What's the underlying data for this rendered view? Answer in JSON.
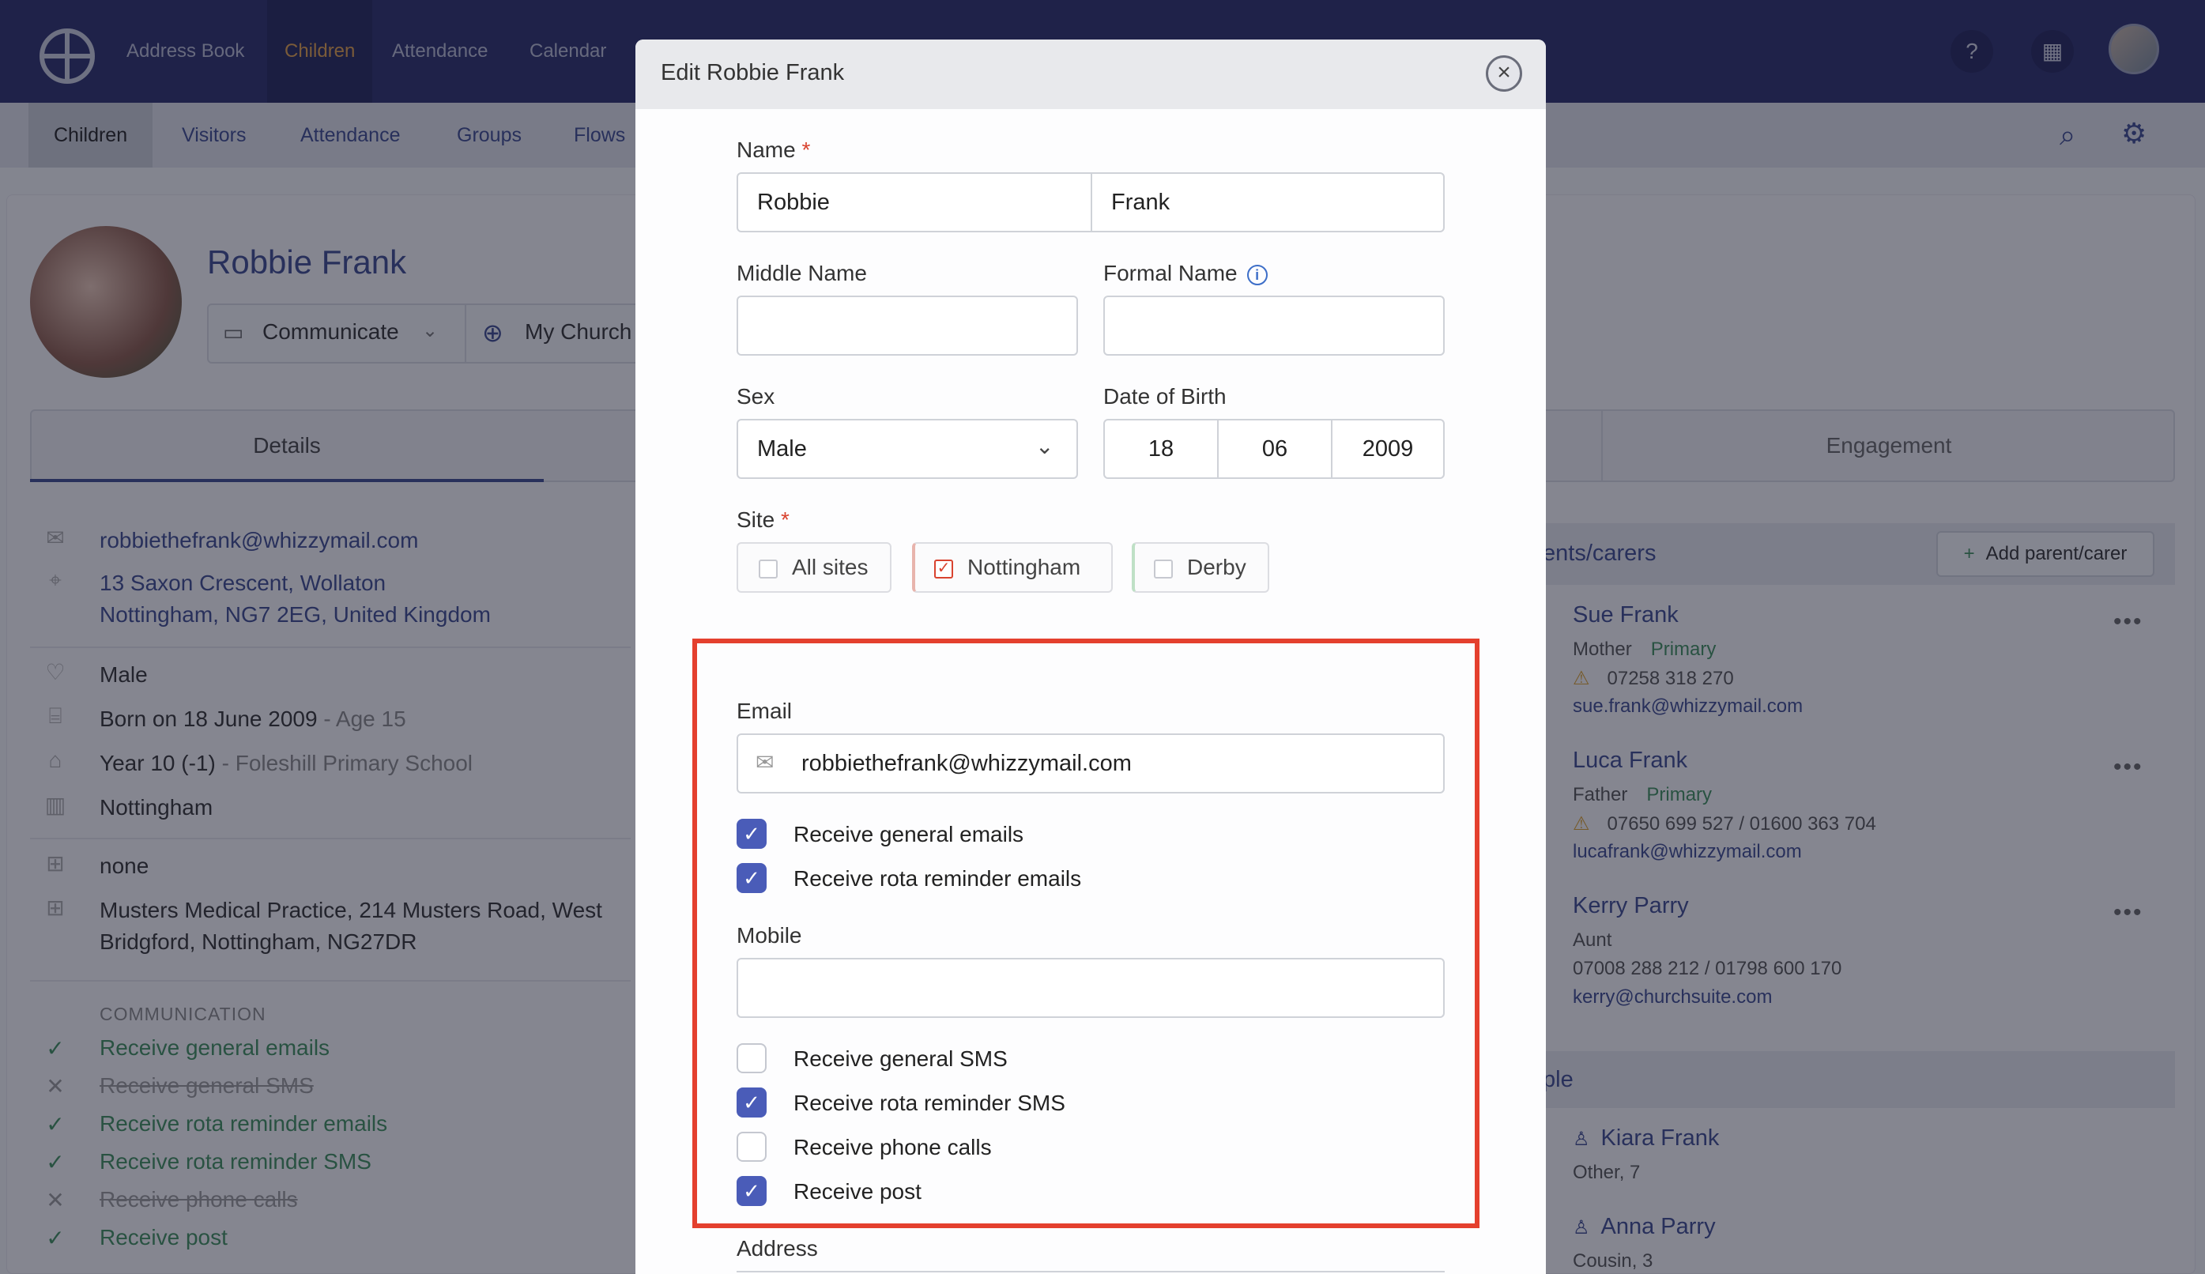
{
  "topnav": {
    "items": [
      "Address Book",
      "Children",
      "Attendance",
      "Calendar"
    ],
    "active": "Children",
    "help_icon": "question-circle-icon",
    "building_icon": "building-icon"
  },
  "subnav": {
    "items": [
      "Children",
      "Visitors",
      "Attendance",
      "Groups",
      "Flows"
    ],
    "active": "Children"
  },
  "profile": {
    "name": "Robbie Frank",
    "communicate": "Communicate",
    "church": "My Church",
    "tabs": {
      "details": "Details",
      "engagement": "Engagement"
    },
    "email": "robbiethefrank@whizzymail.com",
    "address_line1": "13 Saxon Crescent, Wollaton",
    "address_line2": "Nottingham, NG7 2EG, United Kingdom",
    "sex": "Male",
    "born": "Born on 18 June 2009",
    "age": " - Age 15",
    "school_year": "Year 10 (-1)",
    "school": " - Foleshill Primary School",
    "site": "Nottingham",
    "medical_none": "none",
    "doctor_line1": "Musters Medical Practice, 214 Musters Road, West",
    "doctor_line2": "Bridgford, Nottingham, NG27DR",
    "communication_heading": "COMMUNICATION",
    "communication": [
      {
        "label": "Receive general emails",
        "enabled": true
      },
      {
        "label": "Receive general SMS",
        "enabled": false
      },
      {
        "label": "Receive rota reminder emails",
        "enabled": true
      },
      {
        "label": "Receive rota reminder SMS",
        "enabled": true
      },
      {
        "label": "Receive phone calls",
        "enabled": false
      },
      {
        "label": "Receive post",
        "enabled": true
      }
    ]
  },
  "relations": {
    "title": "ents/carers",
    "add_button": "Add parent/carer",
    "carers": [
      {
        "name": "Sue Frank",
        "role": "Mother",
        "primary": "Primary",
        "phone": "07258 318 270",
        "email": "sue.frank@whizzymail.com",
        "warning": true
      },
      {
        "name": "Luca Frank",
        "role": "Father",
        "primary": "Primary",
        "phone": "07650 699 527 / 01600 363 704",
        "email": "lucafrank@whizzymail.com",
        "warning": true
      },
      {
        "name": "Kerry Parry",
        "role": "Aunt",
        "primary": "",
        "phone": "07008 288 212 / 01798 600 170",
        "email": "kerry@churchsuite.com",
        "warning": false
      }
    ],
    "people_title": "ple",
    "people": [
      {
        "name": "Kiara Frank",
        "detail": "Other, 7"
      },
      {
        "name": "Anna Parry",
        "detail": "Cousin, 3"
      }
    ]
  },
  "modal": {
    "title": "Edit Robbie Frank",
    "name_label": "Name",
    "first_name": "Robbie",
    "last_name": "Frank",
    "middle_name_label": "Middle Name",
    "middle_name": "",
    "formal_name_label": "Formal Name",
    "formal_name": "",
    "sex_label": "Sex",
    "sex_value": "Male",
    "dob_label": "Date of Birth",
    "dob_day": "18",
    "dob_month": "06",
    "dob_year": "2009",
    "site_label": "Site",
    "sites": [
      {
        "label": "All sites",
        "checked": false
      },
      {
        "label": "Nottingham",
        "checked": true
      },
      {
        "label": "Derby",
        "checked": false
      }
    ],
    "email_label": "Email",
    "email_value": "robbiethefrank@whizzymail.com",
    "email_options": [
      {
        "label": "Receive general emails",
        "checked": true
      },
      {
        "label": "Receive rota reminder emails",
        "checked": true
      }
    ],
    "mobile_label": "Mobile",
    "mobile_value": "",
    "mobile_options": [
      {
        "label": "Receive general SMS",
        "checked": false
      },
      {
        "label": "Receive rota reminder SMS",
        "checked": true
      },
      {
        "label": "Receive phone calls",
        "checked": false
      },
      {
        "label": "Receive post",
        "checked": true
      }
    ],
    "address_label": "Address"
  },
  "colors": {
    "nav_bg": "#2b2e6b",
    "accent": "#3d4a8f",
    "active_nav": "#e0a04a",
    "highlight": "#e4402e",
    "checkbox": "#4a5cb8",
    "success": "#3f8f5c"
  }
}
